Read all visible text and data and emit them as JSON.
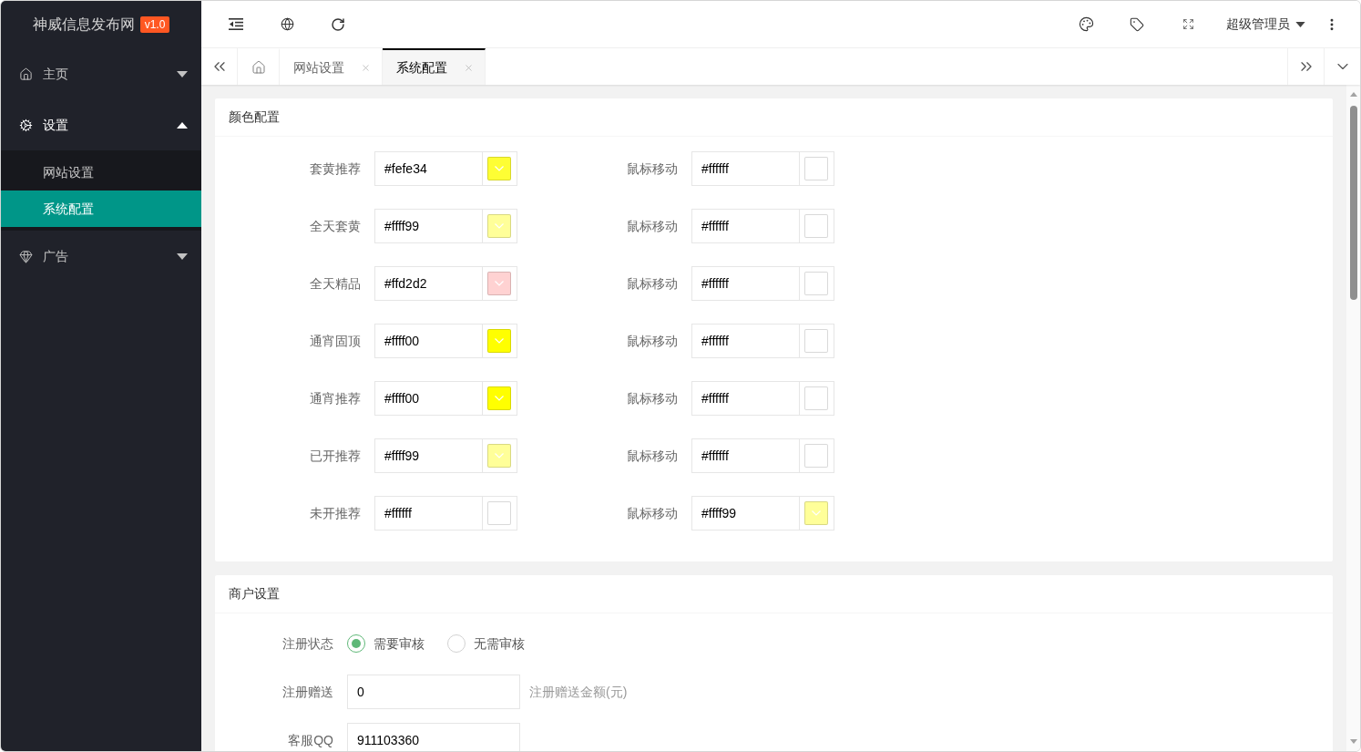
{
  "sidebar": {
    "logo": {
      "title": "神威信息发布网",
      "version": "v1.0"
    },
    "menu": [
      {
        "label": "主页",
        "expanded": false
      },
      {
        "label": "设置",
        "expanded": true,
        "children": [
          {
            "label": "网站设置",
            "selected": false
          },
          {
            "label": "系统配置",
            "selected": true
          }
        ]
      },
      {
        "label": "广告",
        "expanded": false
      }
    ]
  },
  "header": {
    "user": "超级管理员"
  },
  "tabs": [
    {
      "kind": "home",
      "selected": false
    },
    {
      "kind": "page",
      "label": "网站设置",
      "selected": false
    },
    {
      "kind": "page",
      "label": "系统配置",
      "selected": true
    }
  ],
  "sections": [
    {
      "kind": "colors",
      "title": "颜色配置",
      "rows": [
        {
          "left": {
            "label": "套黄推荐",
            "value": "#fefe34",
            "color": "#fefe34"
          },
          "right": {
            "label": "鼠标移动",
            "value": "#ffffff",
            "color": "#ffffff"
          }
        },
        {
          "left": {
            "label": "全天套黄",
            "value": "#ffff99",
            "color": "#ffff99"
          },
          "right": {
            "label": "鼠标移动",
            "value": "#ffffff",
            "color": "#ffffff"
          }
        },
        {
          "left": {
            "label": "全天精品",
            "value": "#ffd2d2",
            "color": "#ffd2d2"
          },
          "right": {
            "label": "鼠标移动",
            "value": "#ffffff",
            "color": "#ffffff"
          }
        },
        {
          "left": {
            "label": "通宵固顶",
            "value": "#ffff00",
            "color": "#ffff00"
          },
          "right": {
            "label": "鼠标移动",
            "value": "#ffffff",
            "color": "#ffffff"
          }
        },
        {
          "left": {
            "label": "通宵推荐",
            "value": "#ffff00",
            "color": "#ffff00"
          },
          "right": {
            "label": "鼠标移动",
            "value": "#ffffff",
            "color": "#ffffff"
          }
        },
        {
          "left": {
            "label": "已开推荐",
            "value": "#ffff99",
            "color": "#ffff99"
          },
          "right": {
            "label": "鼠标移动",
            "value": "#ffffff",
            "color": "#ffffff"
          }
        },
        {
          "left": {
            "label": "未开推荐",
            "value": "#ffffff",
            "color": "#ffffff"
          },
          "right": {
            "label": "鼠标移动",
            "value": "#ffff99",
            "color": "#ffff99"
          }
        }
      ]
    },
    {
      "kind": "form",
      "title": "商户设置",
      "fields": [
        {
          "kind": "radio",
          "label": "注册状态",
          "options": [
            {
              "label": "需要审核",
              "selected": true
            },
            {
              "label": "无需审核",
              "selected": false
            }
          ]
        },
        {
          "kind": "input",
          "label": "注册赠送",
          "value": "0",
          "hint": "注册赠送金额(元)"
        },
        {
          "kind": "input",
          "label": "客服QQ",
          "value": "911103360"
        }
      ]
    }
  ]
}
